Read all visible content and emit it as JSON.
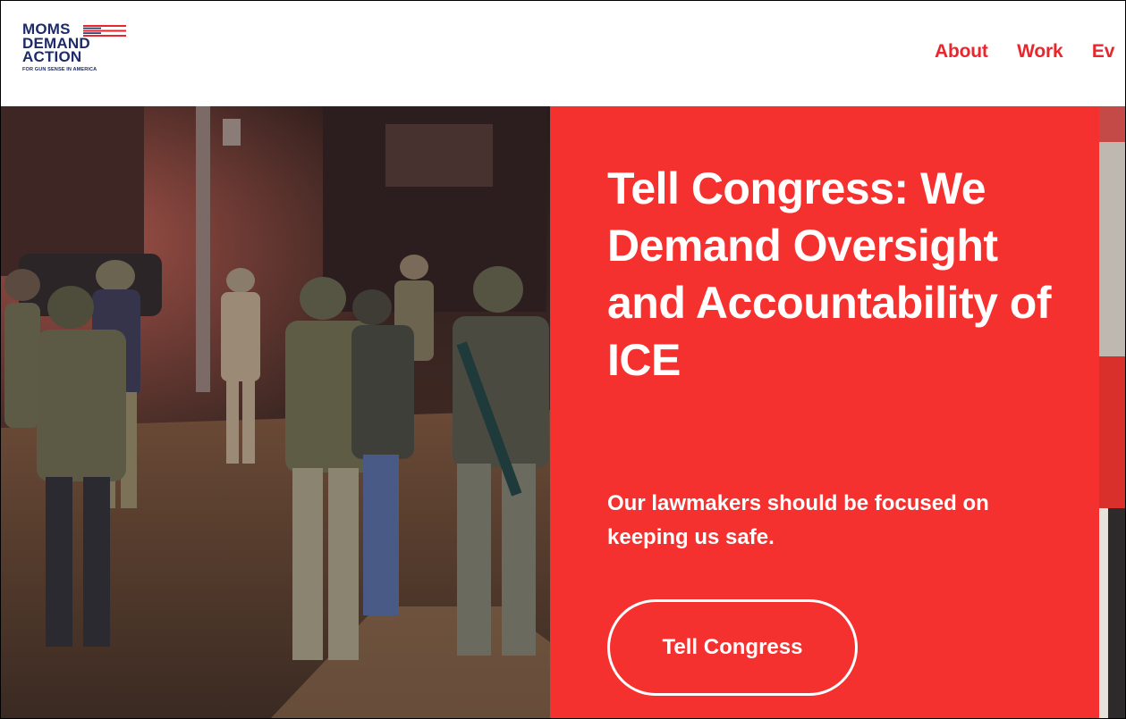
{
  "logo": {
    "line1": "MOMS",
    "line2": "DEMAND",
    "line3": "ACTION",
    "tagline": "FOR GUN SENSE IN AMERICA"
  },
  "nav": {
    "items": [
      "About",
      "Work",
      "Ev"
    ]
  },
  "hero": {
    "headline": "Tell Congress: We Demand Oversight and Accountability of ICE",
    "subtext": "Our lawmakers should be focused on keeping us safe.",
    "cta_label": "Tell Congress"
  },
  "colors": {
    "brand_red": "#f5312f",
    "nav_red": "#e8262d",
    "logo_navy": "#1d2b6b"
  }
}
